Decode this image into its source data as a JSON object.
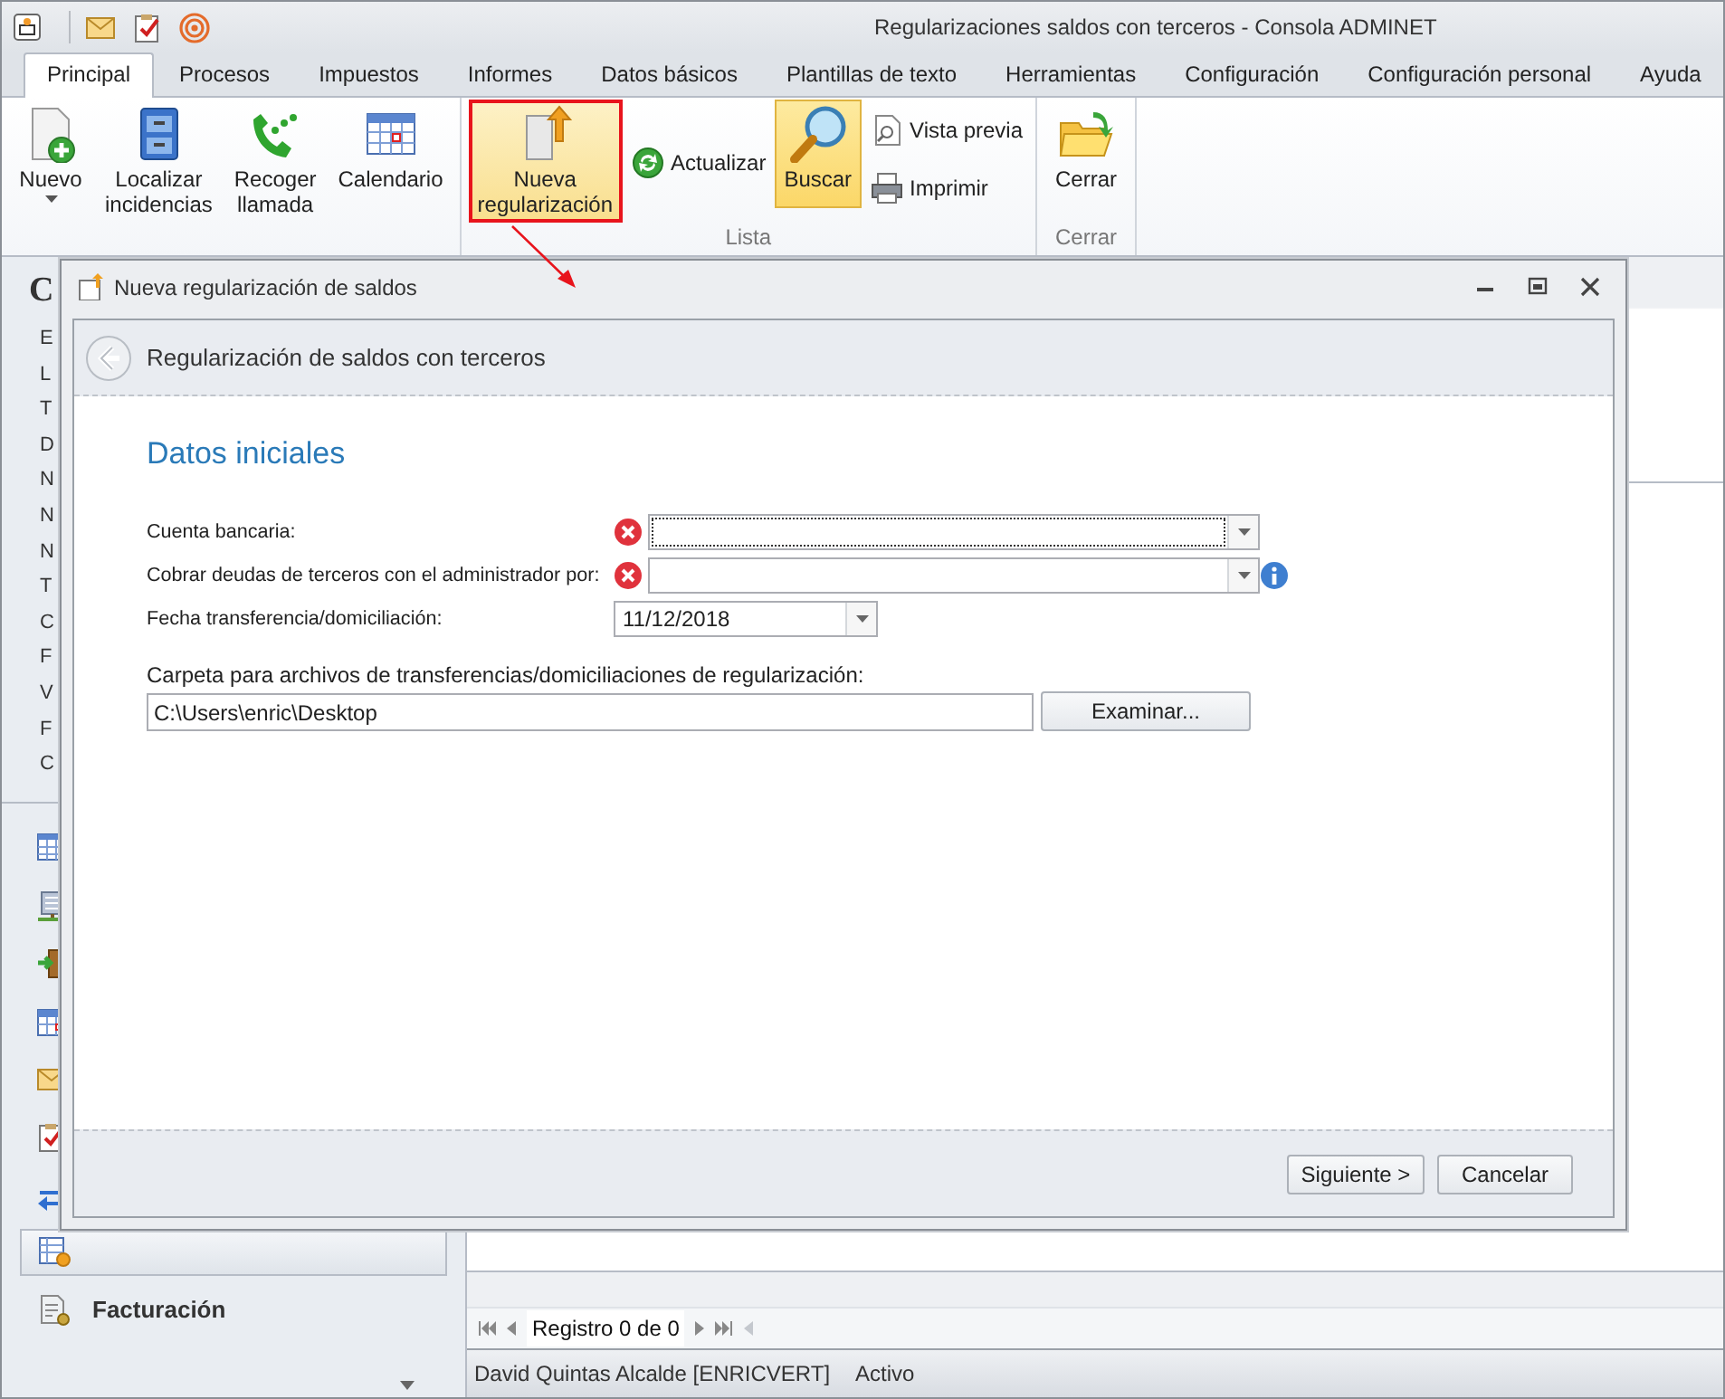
{
  "window": {
    "title": "Regularizaciones saldos con terceros - Consola ADMINET"
  },
  "tabs": [
    {
      "label": "Principal",
      "selected": true
    },
    {
      "label": "Procesos",
      "selected": false
    },
    {
      "label": "Impuestos",
      "selected": false
    },
    {
      "label": "Informes",
      "selected": false
    },
    {
      "label": "Datos básicos",
      "selected": false
    },
    {
      "label": "Plantillas de texto",
      "selected": false
    },
    {
      "label": "Herramientas",
      "selected": false
    },
    {
      "label": "Configuración",
      "selected": false
    },
    {
      "label": "Configuración personal",
      "selected": false
    },
    {
      "label": "Ayuda",
      "selected": false
    }
  ],
  "ribbon": {
    "groups": [
      {
        "items": [
          {
            "label": "Nuevo",
            "kind": "dropdown"
          },
          {
            "label": "Localizar incidencias",
            "kind": "large"
          },
          {
            "label": "Recoger llamada",
            "kind": "large"
          },
          {
            "label": "Calendario",
            "kind": "large"
          }
        ]
      },
      {
        "label": "Lista",
        "items": [
          {
            "label": "Nueva regularización",
            "kind": "large",
            "highlighted": true,
            "active": false
          },
          {
            "label": "Actualizar",
            "kind": "small",
            "active": false
          },
          {
            "label": "Buscar",
            "kind": "large",
            "highlighted": false,
            "active": true
          },
          {
            "label": "Vista previa",
            "kind": "small",
            "active": false
          },
          {
            "label": "Imprimir",
            "kind": "small",
            "active": false
          }
        ]
      },
      {
        "label": "Cerrar",
        "items": [
          {
            "label": "Cerrar",
            "kind": "large",
            "highlighted": false,
            "active": false
          }
        ]
      }
    ]
  },
  "side_panel": {
    "title": "C",
    "items": [
      "E",
      "L",
      "T",
      "D",
      "N",
      "N",
      "N",
      "T",
      "C",
      "F",
      "V",
      "F",
      "C"
    ],
    "nav": [
      {
        "selected": true
      },
      {
        "label": "Facturación",
        "selected": false
      }
    ]
  },
  "dialog": {
    "title": "Nueva regularización de saldos",
    "header": "Regularización de saldos con terceros",
    "section": "Datos iniciales",
    "fields": [
      {
        "label": "Cuenta bancaria:",
        "kind": "combo",
        "error": true,
        "focused": true,
        "info": false
      },
      {
        "label": "Cobrar deudas de terceros con el administrador por:",
        "kind": "combo",
        "error": true,
        "focused": false,
        "info": true
      },
      {
        "label": "Fecha transferencia/domiciliación:",
        "kind": "date",
        "value": "11/12/2018",
        "error": false,
        "focused": false,
        "info": false
      },
      {
        "label": "Carpeta para archivos de transferencias/domiciliaciones de regularización:",
        "kind": "folder",
        "value": "C:\\Users\\enric\\Desktop",
        "button": "Examinar..."
      }
    ],
    "buttons": [
      "Siguiente >",
      "Cancelar"
    ]
  },
  "navigator": {
    "text": "Registro 0 de 0"
  },
  "status_bar": [
    "David Quintas Alcalde [ENRICVERT]",
    "Activo"
  ]
}
